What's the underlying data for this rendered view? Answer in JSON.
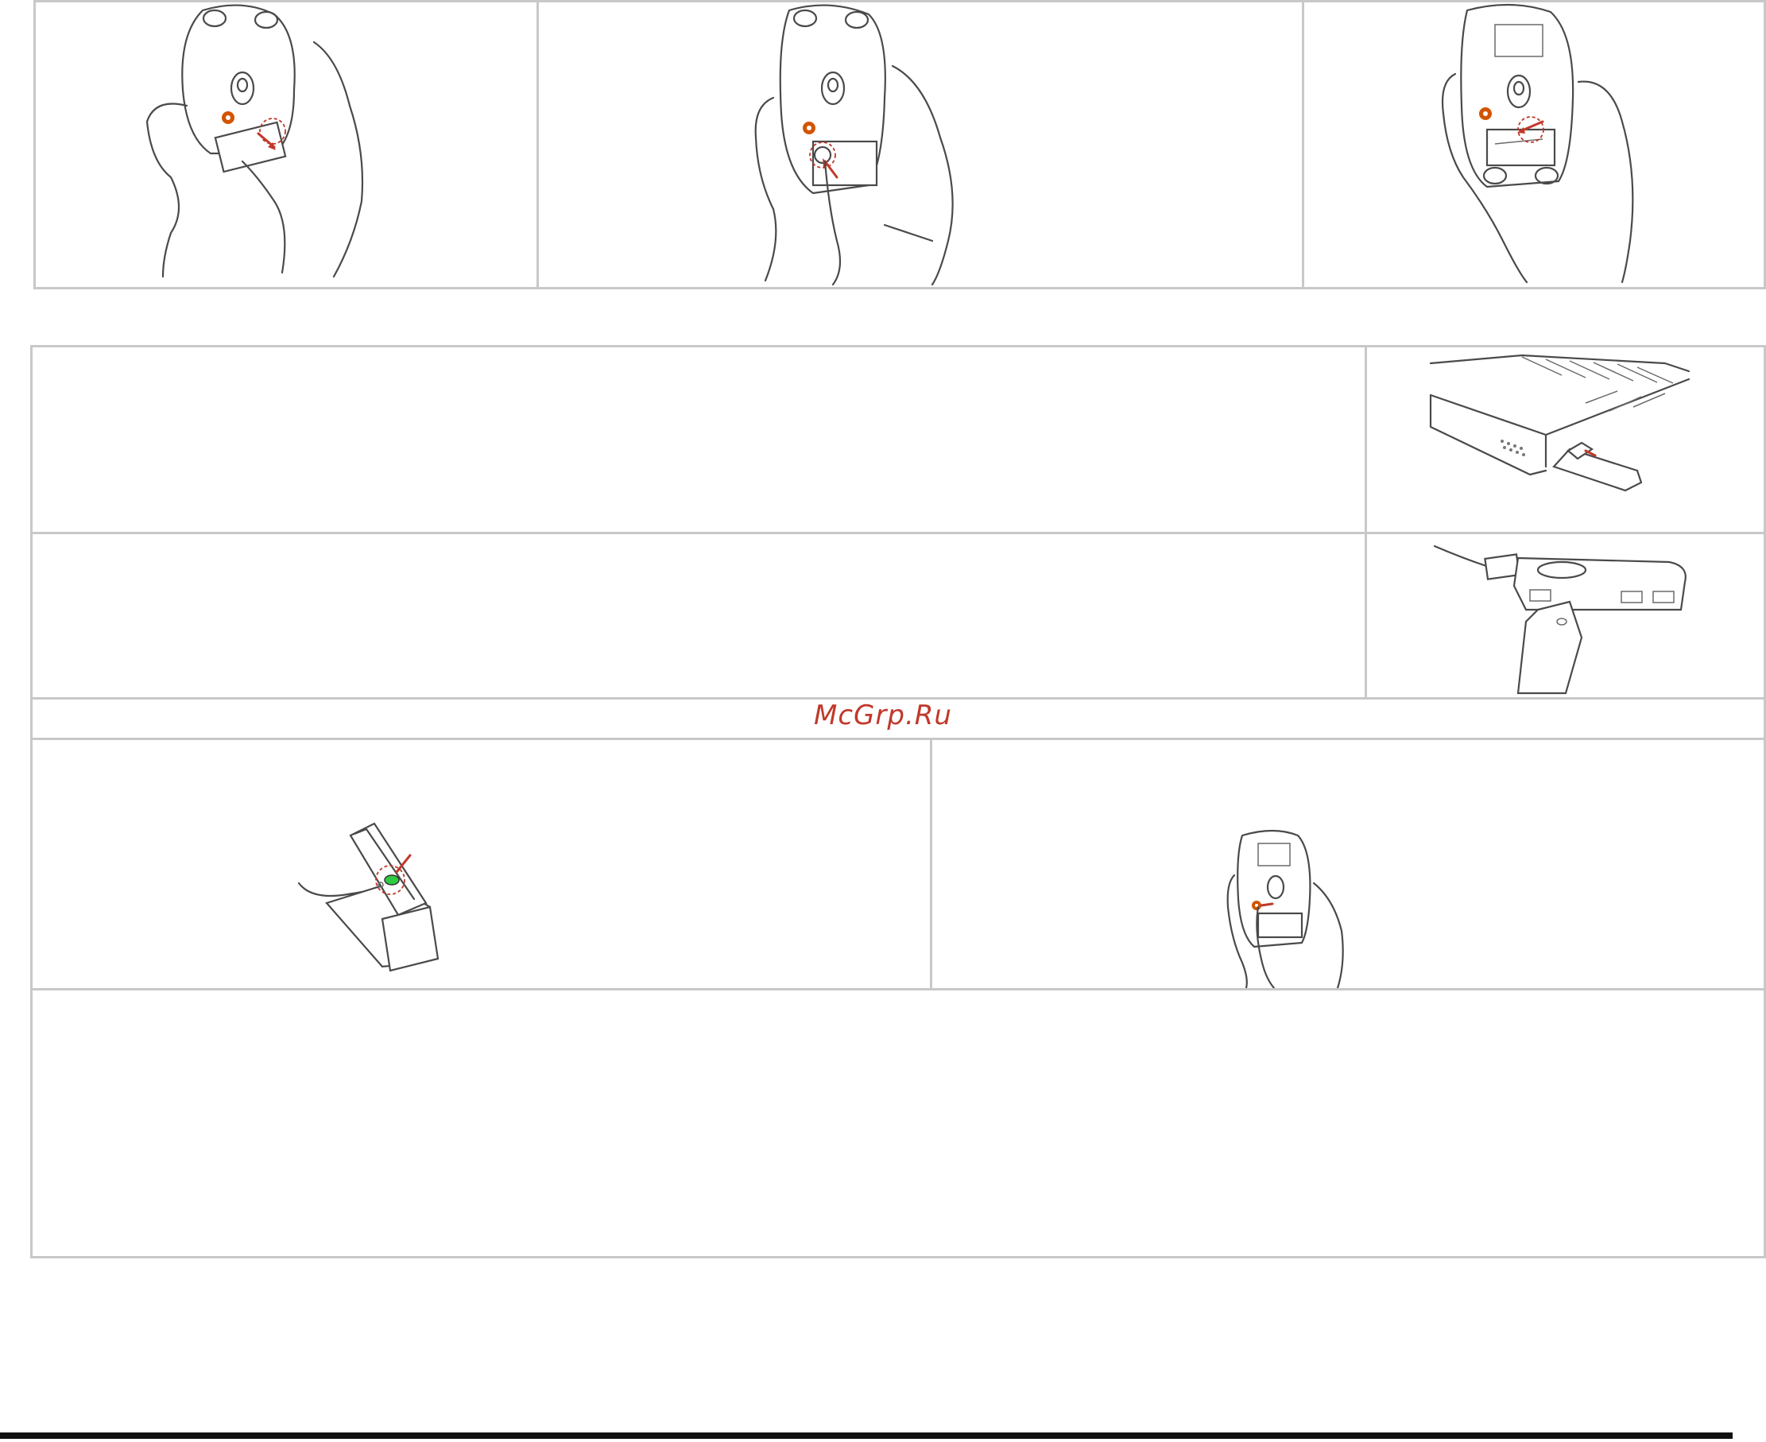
{
  "watermark": {
    "text": "McGrp.Ru",
    "color": "#c0392b"
  },
  "illustrations": {
    "step1": "mouse-open-battery-cover-icon",
    "step2": "mouse-insert-battery-icon",
    "step3": "mouse-close-battery-cover-icon",
    "laptop": "laptop-usb-receiver-icon",
    "hub": "usb-hub-receiver-icon",
    "cradle": "receiver-cradle-led-icon",
    "connect": "mouse-connect-button-icon"
  },
  "colors": {
    "accent_red": "#c0392b",
    "led_green": "#2ecc40",
    "orange_button": "#d35400",
    "border_grey": "#c8c8c8"
  }
}
